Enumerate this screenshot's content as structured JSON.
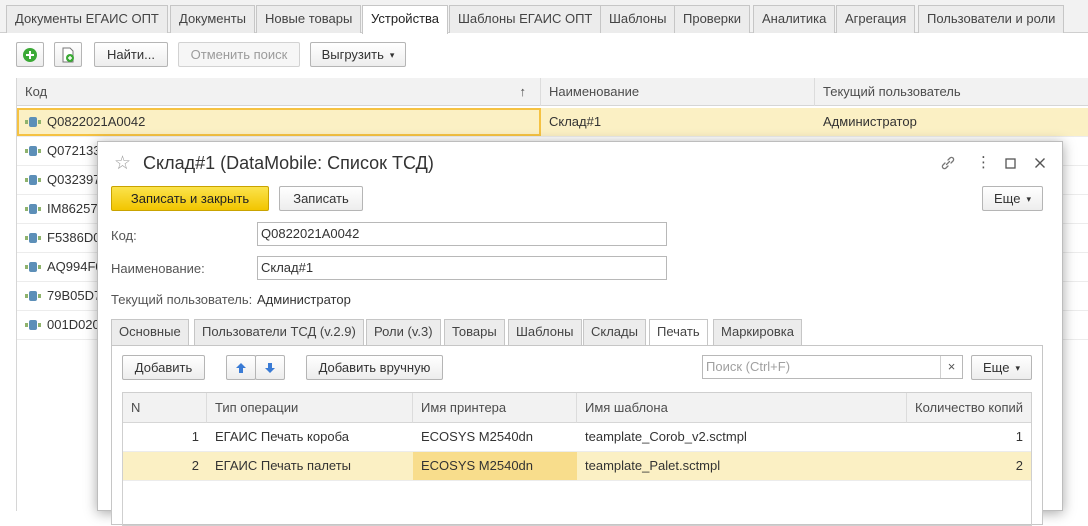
{
  "top_tabs": [
    {
      "label": "Документы ЕГАИС ОПТ",
      "active": false
    },
    {
      "label": "Документы",
      "active": false
    },
    {
      "label": "Новые товары",
      "active": false
    },
    {
      "label": "Устройства",
      "active": true
    },
    {
      "label": "Шаблоны ЕГАИС ОПТ",
      "active": false
    },
    {
      "label": "Шаблоны",
      "active": false
    },
    {
      "label": "Проверки",
      "active": false
    },
    {
      "label": "Аналитика",
      "active": false
    },
    {
      "label": "Агрегация",
      "active": false
    },
    {
      "label": "Пользователи и роли",
      "active": false
    }
  ],
  "toolbar": {
    "find_label": "Найти...",
    "cancel_search_label": "Отменить поиск",
    "export_label": "Выгрузить"
  },
  "list": {
    "columns": [
      "Код",
      "Наименование",
      "Текущий пользователь"
    ],
    "sort_indicator": "↑",
    "rows": [
      {
        "code": "Q0822021A0042",
        "name": "Склад#1",
        "user": "Администратор"
      },
      {
        "code": "Q0721330",
        "name": "",
        "user": ""
      },
      {
        "code": "Q0323970",
        "name": "",
        "user": ""
      },
      {
        "code": "IM862570",
        "name": "",
        "user": ""
      },
      {
        "code": "F5386D0",
        "name": "",
        "user": ""
      },
      {
        "code": "AQ994F0",
        "name": "",
        "user": ""
      },
      {
        "code": "79B05D70",
        "name": "",
        "user": ""
      },
      {
        "code": "001D0200",
        "name": "",
        "user": ""
      }
    ]
  },
  "modal": {
    "title": "Склад#1 (DataMobile: Список ТСД)",
    "save_close_label": "Записать и закрыть",
    "save_label": "Записать",
    "more_label": "Еще",
    "code_label": "Код:",
    "code_value": "Q0822021A0042",
    "name_label": "Наименование:",
    "name_value": "Склад#1",
    "current_user_label": "Текущий пользователь:",
    "current_user_value": "Администратор",
    "tabs": [
      {
        "label": "Основные",
        "active": false
      },
      {
        "label": "Пользователи ТСД (v.2.9)",
        "active": false
      },
      {
        "label": "Роли (v.3)",
        "active": false
      },
      {
        "label": "Товары",
        "active": false
      },
      {
        "label": "Шаблоны",
        "active": false
      },
      {
        "label": "Склады",
        "active": false
      },
      {
        "label": "Печать",
        "active": true
      },
      {
        "label": "Маркировка",
        "active": false
      }
    ],
    "print_tab": {
      "add_label": "Добавить",
      "add_manual_label": "Добавить вручную",
      "search_placeholder": "Поиск (Ctrl+F)",
      "clear_label": "×",
      "more_label": "Еще",
      "columns": [
        "N",
        "Тип операции",
        "Имя принтера",
        "Имя шаблона",
        "Количество копий"
      ],
      "rows": [
        {
          "n": "1",
          "operation": "ЕГАИС Печать короба",
          "printer": "ECOSYS M2540dn",
          "template": "teamplate_Corob_v2.sctmpl",
          "copies": "1"
        },
        {
          "n": "2",
          "operation": "ЕГАИС Печать палеты",
          "printer": "ECOSYS M2540dn",
          "template": "teamplate_Palet.sctmpl",
          "copies": "2"
        }
      ]
    }
  },
  "colors": {
    "accent_yellow": "#f2c500",
    "selection": "#fbf0c4",
    "add_green": "#3aa935",
    "arrow_blue": "#3a7bd5"
  }
}
